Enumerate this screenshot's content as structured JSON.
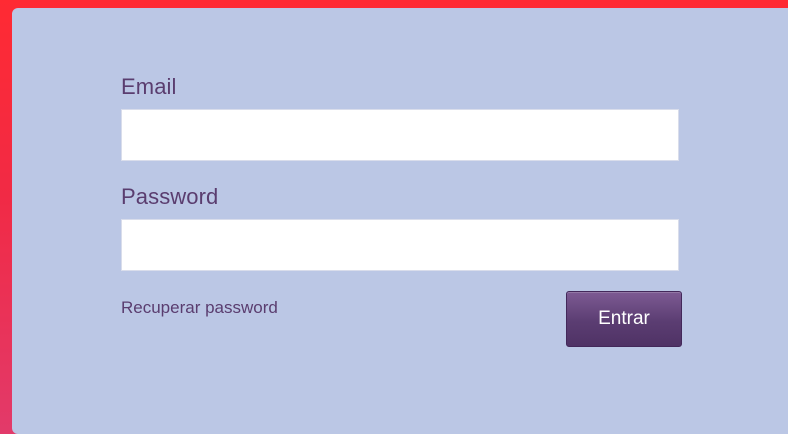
{
  "login_form": {
    "email_label": "Email",
    "email_value": "",
    "password_label": "Password",
    "password_value": "",
    "recover_password_label": "Recuperar password",
    "submit_label": "Entrar"
  }
}
